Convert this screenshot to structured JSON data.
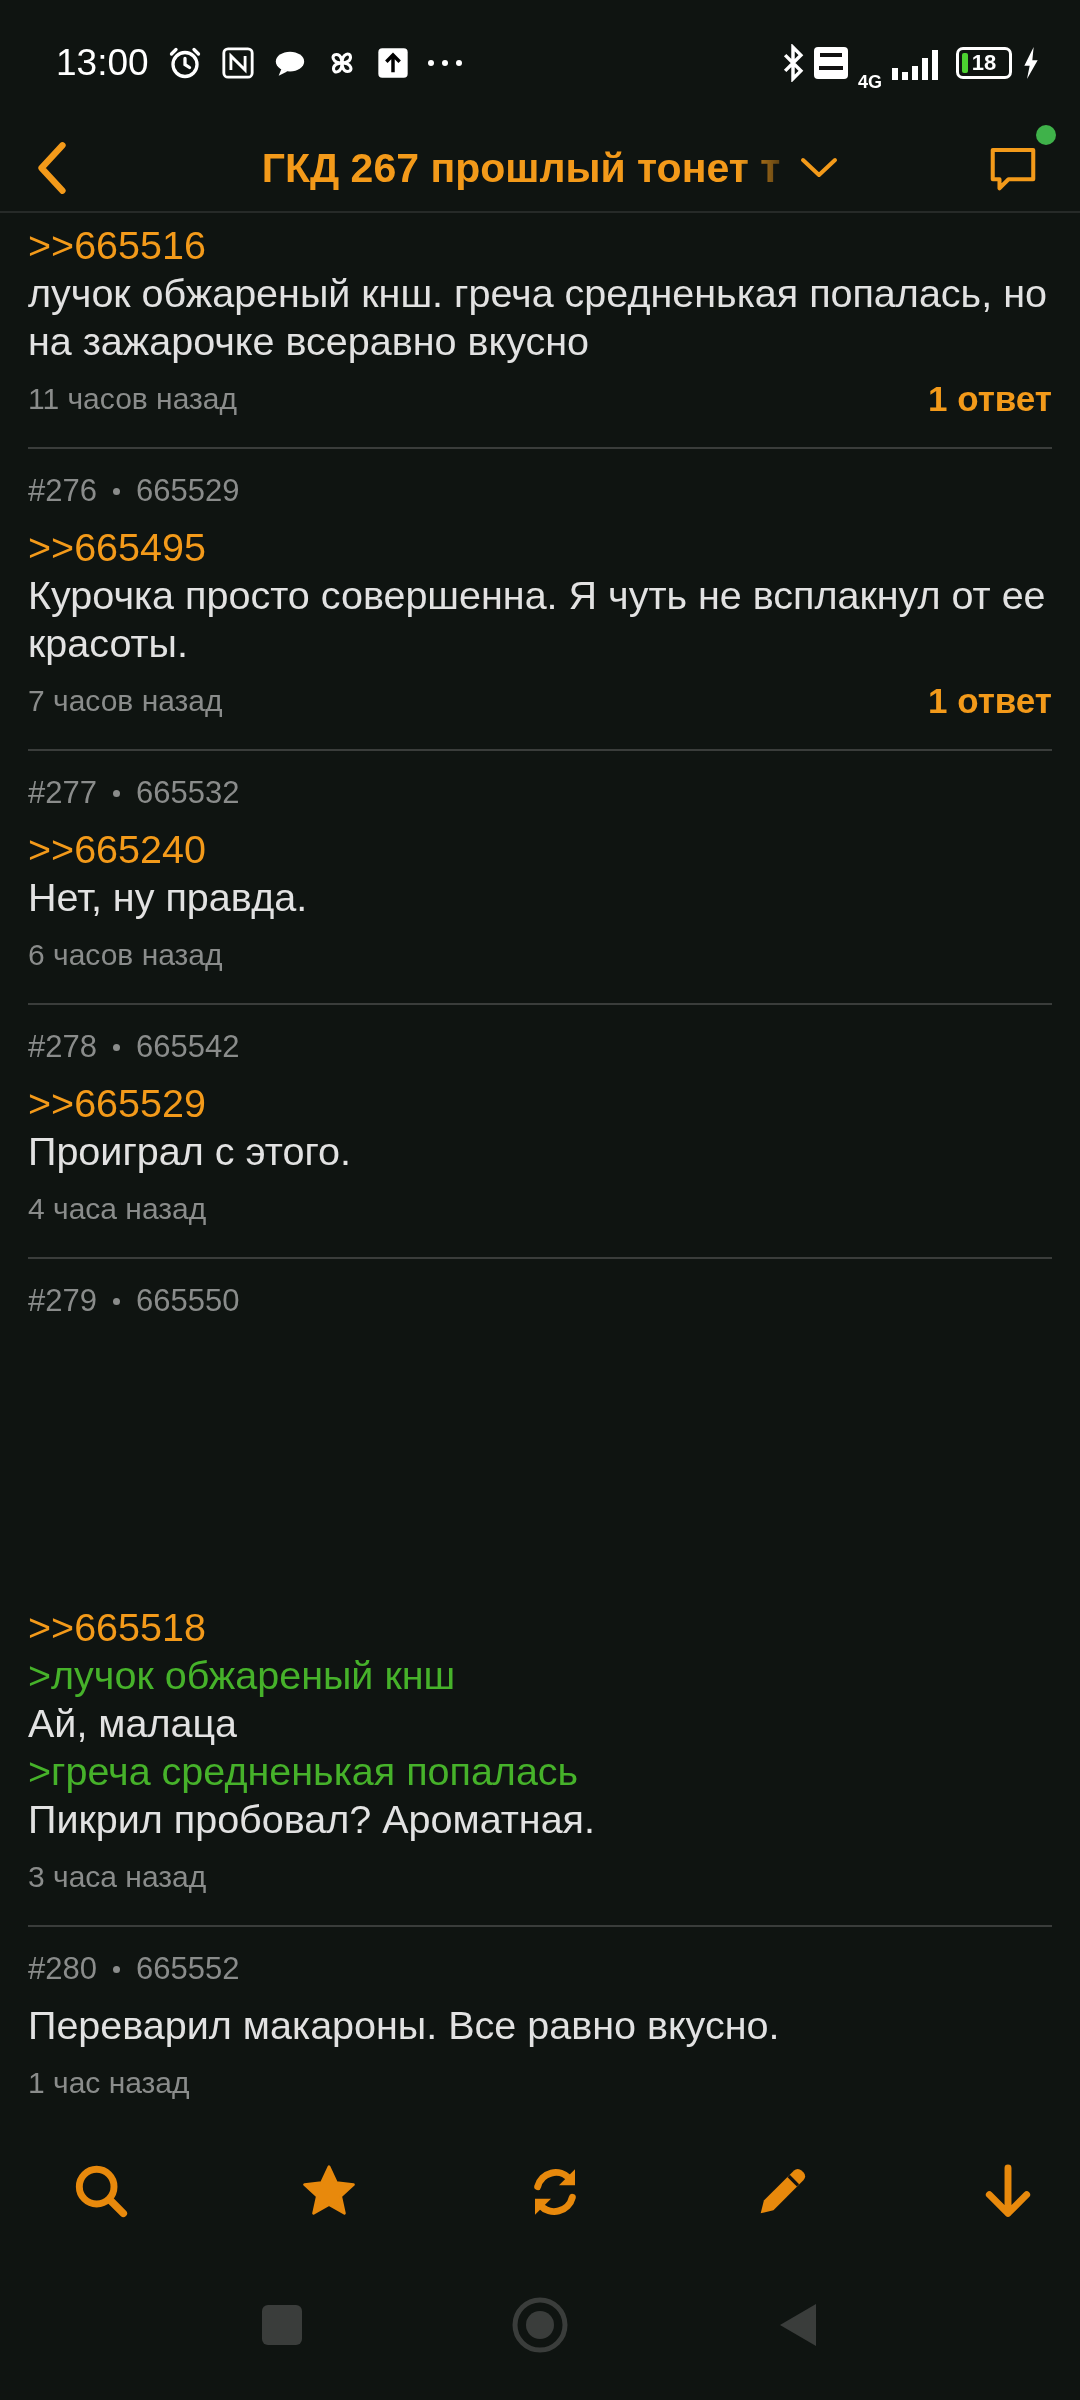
{
  "status_bar": {
    "time": "13:00",
    "network": "4G",
    "battery": "18"
  },
  "header": {
    "title": "ГКД 267 прошлый тонет т",
    "unread": true
  },
  "posts": [
    {
      "lines": [
        {
          "kind": "reply",
          "text": ">>665516"
        },
        {
          "kind": "text",
          "text": "лучок обжареный кнш. греча средненькая попалась, но на зажарочке всеравно вкусно"
        }
      ],
      "time": "11 часов назад",
      "replies": "1 ответ"
    },
    {
      "number": "#276",
      "id": "665529",
      "lines": [
        {
          "kind": "reply",
          "text": ">>665495"
        },
        {
          "kind": "text",
          "text": "Курочка просто совершенна. Я чуть не всплакнул от ее красоты."
        }
      ],
      "time": "7 часов назад",
      "replies": "1 ответ"
    },
    {
      "number": "#277",
      "id": "665532",
      "lines": [
        {
          "kind": "reply",
          "text": ">>665240"
        },
        {
          "kind": "text",
          "text": "Нет, ну правда."
        }
      ],
      "time": "6 часов назад"
    },
    {
      "number": "#278",
      "id": "665542",
      "lines": [
        {
          "kind": "reply",
          "text": ">>665529"
        },
        {
          "kind": "text",
          "text": "Проиграл с этого."
        }
      ],
      "time": "4 часа назад"
    },
    {
      "number": "#279",
      "id": "665550",
      "attachment_pending": true,
      "lines": [
        {
          "kind": "reply",
          "text": ">>665518"
        },
        {
          "kind": "quote",
          "text": ">лучок обжареный кнш"
        },
        {
          "kind": "text",
          "text": "Ай, малаца"
        },
        {
          "kind": "quote",
          "text": ">греча средненькая попалась"
        },
        {
          "kind": "text",
          "text": "Пикрил пробовал? Ароматная."
        }
      ],
      "time": "3 часа назад"
    },
    {
      "number": "#280",
      "id": "665552",
      "lines": [
        {
          "kind": "text",
          "text": "Переварил макароны. Все равно вкусно."
        }
      ],
      "time": "1 час назад"
    }
  ]
}
